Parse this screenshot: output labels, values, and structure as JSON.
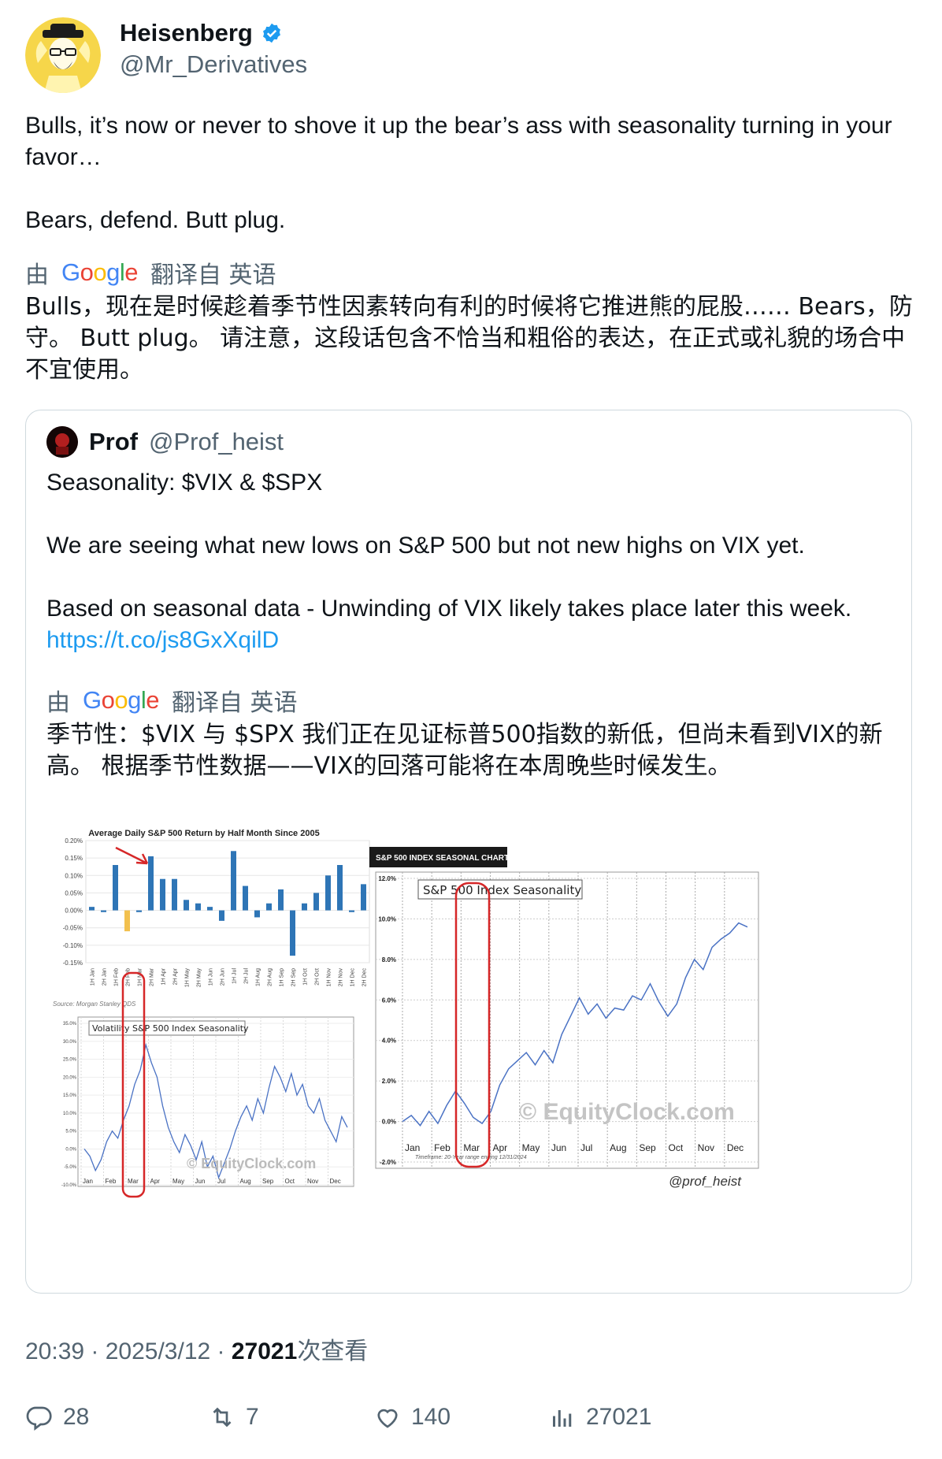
{
  "author": {
    "display_name": "Heisenberg",
    "handle": "@Mr_Derivatives"
  },
  "tweet": {
    "paragraphs": [
      "Bulls, it’s now or never to shove it up the bear’s ass with seasonality turning in your favor…",
      "Bears, defend. Butt plug."
    ]
  },
  "translation": {
    "prefix": "由",
    "suffix": "翻译自 英语",
    "text": "Bulls，现在是时候趁着季节性因素转向有利的时候将它推进熊的屁股…… Bears，防守。 Butt plug。 请注意，这段话包含不恰当和粗俗的表达，在正式或礼貌的场合中不宜使用。"
  },
  "quote": {
    "display_name": "Prof",
    "handle": "@Prof_heist",
    "p1": "Seasonality: $VIX & $SPX",
    "p2": "We are seeing what new lows on S&P 500 but not new highs on VIX yet.",
    "p3": "Based on seasonal data - Unwinding of VIX likely takes place later this week.",
    "link": "https://t.co/js8GxXqilD",
    "translation": {
      "prefix": "由",
      "suffix": "翻译自 英语",
      "text": "季节性：$VIX 与 $SPX 我们正在见证标普500指数的新低，但尚未看到VIX的新高。 根据季节性数据——VIX的回落可能将在本周晚些时候发生。"
    }
  },
  "chart_images": {
    "bar_title": "Average Daily S&P 500 Return by Half Month Since 2005",
    "bar_source": "Source: Morgan Stanley QDS",
    "vix_title": "Volatility S&P 500 Index Seasonality",
    "spx_header": "S&P 500 INDEX SEASONAL CHART",
    "spx_title": "S&P 500 Index Seasonality",
    "watermark": "© EquityClock.com",
    "signature": "@prof_heist",
    "timeframe": "Timeframe: 20-Year range ending 12/31/2024",
    "bar_yticks": [
      "0.20%",
      "0.15%",
      "0.10%",
      "0.05%",
      "0.00%",
      "-0.05%",
      "-0.10%",
      "-0.15%"
    ],
    "bar_categories": [
      "1H Jan",
      "2H Jan",
      "1H Feb",
      "2H Feb",
      "1H Mar",
      "2H Mar",
      "1H Apr",
      "2H Apr",
      "1H May",
      "2H May",
      "1H Jun",
      "2H Jun",
      "1H Jul",
      "2H Jul",
      "1H Aug",
      "2H Aug",
      "1H Sep",
      "2H Sep",
      "1H Oct",
      "2H Oct",
      "1H Nov",
      "2H Nov",
      "1H Dec",
      "2H Dec"
    ],
    "bar_values": [
      0.01,
      -0.005,
      0.13,
      -0.06,
      -0.005,
      0.155,
      0.09,
      0.09,
      0.03,
      0.02,
      0.01,
      -0.03,
      0.17,
      0.07,
      -0.02,
      0.02,
      0.06,
      -0.13,
      0.02,
      0.05,
      0.1,
      0.13,
      -0.005,
      0.075
    ],
    "vix_yticks": [
      "35.0%",
      "30.0%",
      "25.0%",
      "20.0%",
      "15.0%",
      "10.0%",
      "5.0%",
      "0.0%",
      "-5.0%",
      "-10.0%"
    ],
    "spx_yticks": [
      "12.0%",
      "10.0%",
      "8.0%",
      "6.0%",
      "4.0%",
      "2.0%",
      "0.0%",
      "-2.0%"
    ],
    "months": [
      "Jan",
      "Feb",
      "Mar",
      "Apr",
      "May",
      "Jun",
      "Jul",
      "Aug",
      "Sep",
      "Oct",
      "Nov",
      "Dec"
    ]
  },
  "meta": {
    "time": "20:39 · 2025/3/12 ·",
    "views": "27021",
    "views_suffix": "次查看"
  },
  "actions": {
    "replies": "28",
    "reposts": "7",
    "likes": "140",
    "views": "27021"
  },
  "colors": {
    "link": "#1d9bf0",
    "verified": "#1d9bf0",
    "secondary_text": "#536471",
    "bar_blue": "#2e75b6",
    "bar_yellow": "#f2c04e",
    "line_blue": "#4a72c4",
    "highlight_red": "#d62728"
  }
}
